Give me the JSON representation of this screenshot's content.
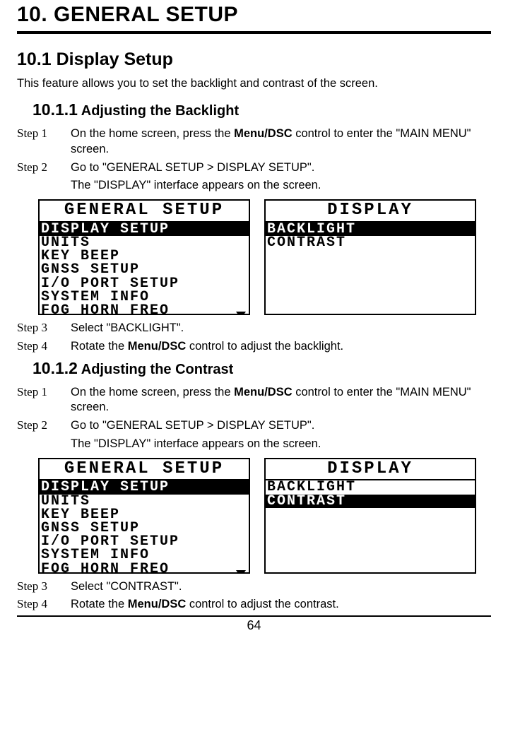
{
  "chapter_title": "10. GENERAL SETUP",
  "section_title": "10.1 Display Setup",
  "intro": "This feature allows you to set the backlight and contrast of the screen.",
  "sub1": {
    "num": "10.1.1",
    "title": " Adjusting the Backlight"
  },
  "sub2": {
    "num": "10.1.2",
    "title": " Adjusting the Contrast"
  },
  "backlight": {
    "step1_label": "Step 1",
    "step1_a": "On the home screen, press the ",
    "step1_b": "Menu/DSC",
    "step1_c": " control to enter the \"MAIN MENU\" screen.",
    "step2_label": "Step 2",
    "step2": "Go to \"GENERAL SETUP > DISPLAY SETUP\".",
    "step2_cont": "The \"DISPLAY\" interface appears on the screen.",
    "step3_label": "Step 3",
    "step3": "Select \"BACKLIGHT\".",
    "step4_label": "Step 4",
    "step4_a": "Rotate the ",
    "step4_b": "Menu/DSC",
    "step4_c": " control to adjust the backlight."
  },
  "contrast": {
    "step1_label": "Step 1",
    "step1_a": "On the home screen, press the ",
    "step1_b": "Menu/DSC",
    "step1_c": " control to enter the \"MAIN MENU\" screen.",
    "step2_label": "Step 2",
    "step2": "Go to \"GENERAL SETUP > DISPLAY SETUP\".",
    "step2_cont": "The \"DISPLAY\" interface appears on the screen.",
    "step3_label": "Step 3",
    "step3": "Select \"CONTRAST\".",
    "step4_label": "Step 4",
    "step4_a": "Rotate the ",
    "step4_b": "Menu/DSC",
    "step4_c": " control to adjust the contrast."
  },
  "screen_left": {
    "title": "GENERAL SETUP",
    "lines": [
      "DISPLAY SETUP",
      "UNITS",
      "KEY BEEP",
      "GNSS SETUP",
      "I/O PORT SETUP",
      "SYSTEM INFO",
      "FOG HORN FREQ"
    ]
  },
  "screen_right_backlight": {
    "title": "DISPLAY",
    "lines": [
      "BACKLIGHT",
      "CONTRAST"
    ]
  },
  "screen_right_contrast": {
    "title": "DISPLAY",
    "lines": [
      "BACKLIGHT",
      "CONTRAST"
    ]
  },
  "page_number": "64"
}
